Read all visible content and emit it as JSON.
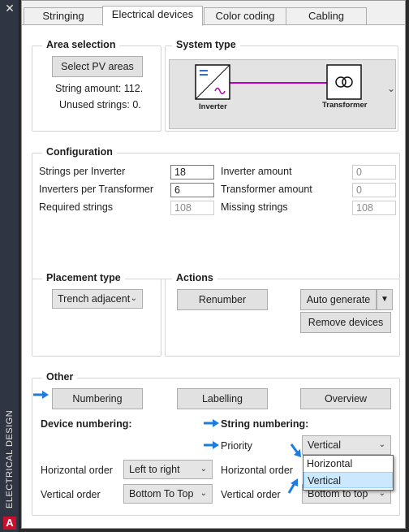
{
  "sidebar": {
    "title": "ELECTRICAL DESIGN",
    "close_glyph": "✕",
    "logo_letter": "A"
  },
  "tabs": [
    {
      "label": "Stringing"
    },
    {
      "label": "Electrical devices"
    },
    {
      "label": "Color coding"
    },
    {
      "label": "Cabling"
    }
  ],
  "area_selection": {
    "title": "Area selection",
    "select_button": "Select PV areas",
    "string_amount": "String amount: 112.",
    "unused_strings": "Unused strings: 0."
  },
  "system_type": {
    "title": "System type",
    "inverter_label": "Inverter",
    "transformer_label": "Transformer",
    "expand_glyph": "⌄",
    "line_color": "#c000c0",
    "icon_color": "#2f6fdc"
  },
  "configuration": {
    "title": "Configuration",
    "strings_per_inverter_label": "Strings per Inverter",
    "strings_per_inverter_value": "18",
    "inverters_per_transformer_label": "Inverters per Transformer",
    "inverters_per_transformer_value": "6",
    "required_strings_label": "Required strings",
    "required_strings_value": "108",
    "inverter_amount_label": "Inverter amount",
    "inverter_amount_value": "0",
    "transformer_amount_label": "Transformer amount",
    "transformer_amount_value": "0",
    "missing_strings_label": "Missing strings",
    "missing_strings_value": "108"
  },
  "placement": {
    "title": "Placement type",
    "selected": "Trench adjacent"
  },
  "actions": {
    "title": "Actions",
    "renumber": "Renumber",
    "auto_generate": "Auto generate",
    "remove_devices": "Remove devices"
  },
  "other": {
    "title": "Other",
    "numbering": "Numbering",
    "labelling": "Labelling",
    "overview": "Overview",
    "device_numbering": "Device numbering:",
    "string_numbering": "String numbering:",
    "priority_label": "Priority",
    "priority_selected": "Vertical",
    "priority_options": [
      "Horizontal",
      "Vertical"
    ],
    "device_horizontal_label": "Horizontal order",
    "device_horizontal_value": "Left to right",
    "device_vertical_label": "Vertical order",
    "device_vertical_value": "Bottom To Top",
    "string_horizontal_label": "Horizontal order",
    "string_vertical_label": "Vertical order",
    "string_vertical_value": "Bottom to top"
  },
  "colors": {
    "arrow": "#1e7be0",
    "dropdown_highlight": "#cce8ff"
  }
}
